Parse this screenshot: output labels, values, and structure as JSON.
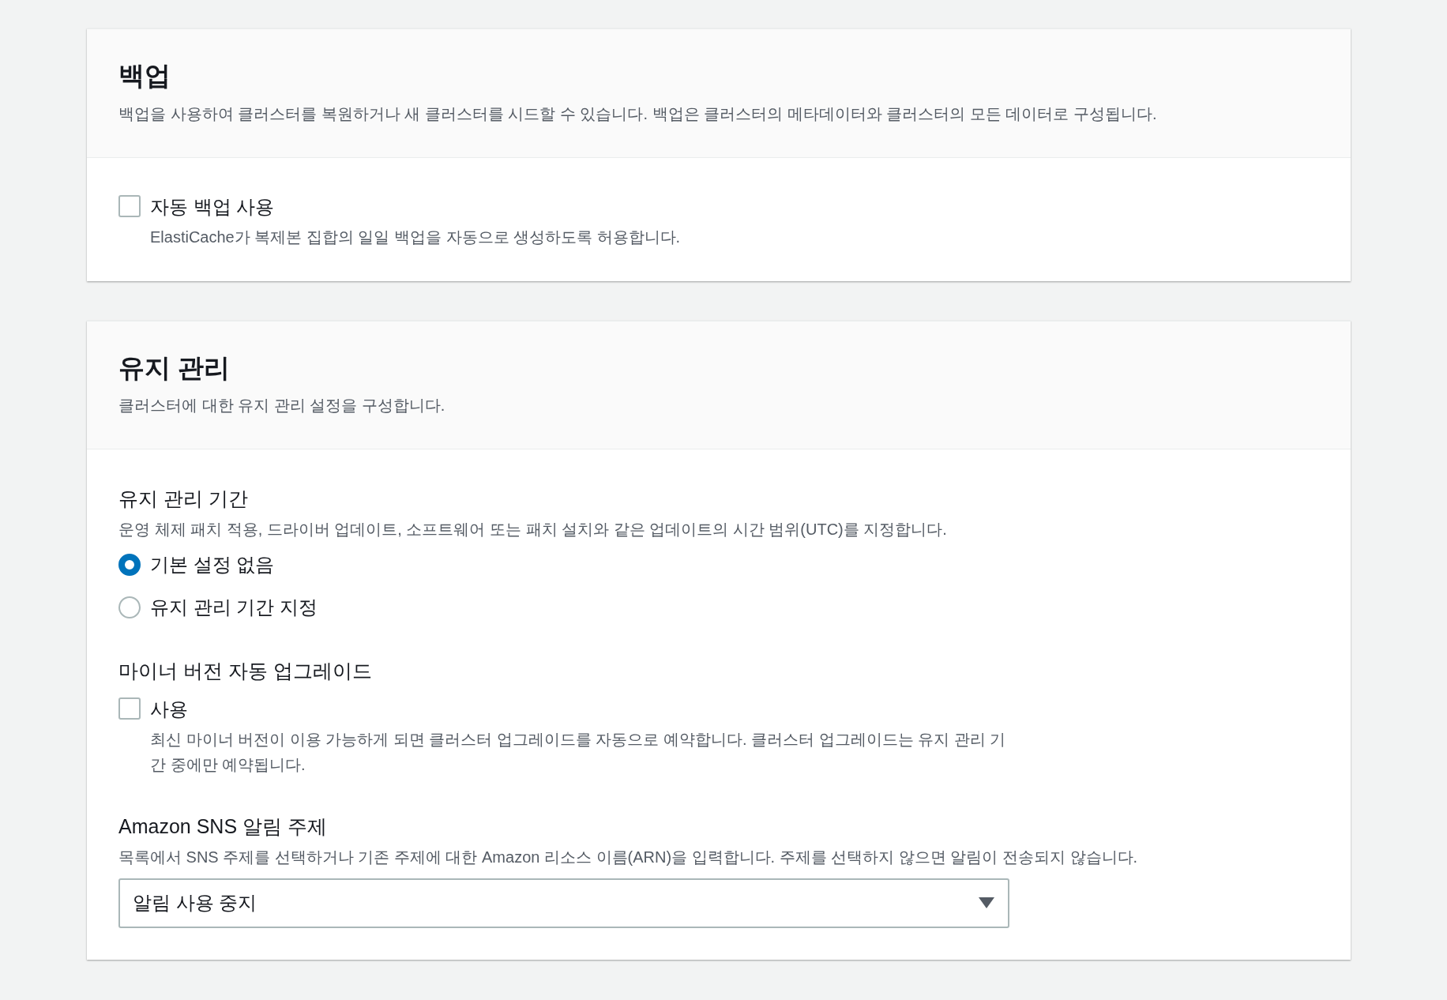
{
  "sections": [
    {
      "title": "백업",
      "description": "백업을 사용하여 클러스터를 복원하거나 새 클러스터를 시드할 수 있습니다. 백업은 클러스터의 메타데이터와 클러스터의 모든 데이터로 구성됩니다.",
      "fields": [
        {
          "kind": "checkbox",
          "label": "자동 백업 사용",
          "checked": false,
          "description": "ElastiCache가 복제본 집합의 일일 백업을 자동으로 생성하도록 허용합니다."
        }
      ]
    },
    {
      "title": "유지 관리",
      "description": "클러스터에 대한 유지 관리 설정을 구성합니다.",
      "fields": [
        {
          "kind": "radio_group",
          "label": "유지 관리 기간",
          "description": "운영 체제 패치 적용, 드라이버 업데이트, 소프트웨어 또는 패치 설치와 같은 업데이트의 시간 범위(UTC)를 지정합니다.",
          "options": [
            {
              "label": "기본 설정 없음",
              "selected": true
            },
            {
              "label": "유지 관리 기간 지정",
              "selected": false
            }
          ]
        },
        {
          "kind": "checkbox",
          "heading": "마이너 버전 자동 업그레이드",
          "label": "사용",
          "checked": false,
          "description": "최신 마이너 버전이 이용 가능하게 되면 클러스터 업그레이드를 자동으로 예약합니다. 클러스터 업그레이드는 유지 관리 기간 중에만 예약됩니다."
        },
        {
          "kind": "select",
          "label": "Amazon SNS 알림 주제",
          "description": "목록에서 SNS 주제를 선택하거나 기존 주제에 대한 Amazon 리소스 이름(ARN)을 입력합니다. 주제를 선택하지 않으면 알림이 전송되지 않습니다.",
          "value": "알림 사용 중지"
        }
      ]
    }
  ]
}
